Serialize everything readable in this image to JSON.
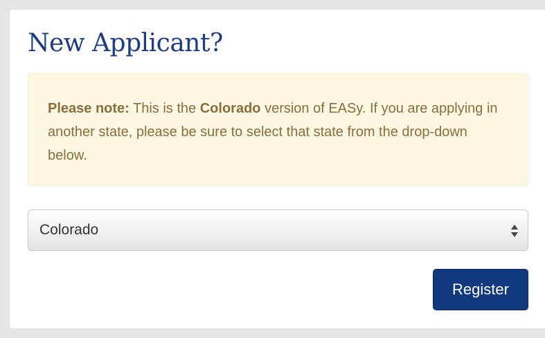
{
  "heading": "New Applicant?",
  "notice": {
    "bold_prefix": "Please note:",
    "text_before_state": " This is the ",
    "state_bold": "Colorado",
    "text_after_state": " version of EASy. If you are applying in another state, please be sure to select that state from the drop-down below."
  },
  "state_select": {
    "selected": "Colorado",
    "icon": "updown-arrows-icon"
  },
  "register_label": "Register",
  "colors": {
    "heading": "#1e3c80",
    "alert_bg": "#fcf8e3",
    "alert_text": "#8a6d3b",
    "button_bg": "#11397f"
  }
}
